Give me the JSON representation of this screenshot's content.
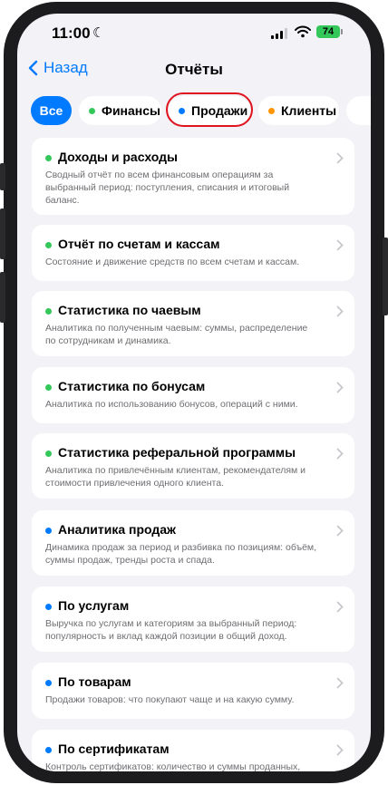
{
  "status": {
    "time": "11:00",
    "battery": "74"
  },
  "nav": {
    "back_label": "Назад",
    "title": "Отчёты"
  },
  "chips": [
    {
      "label": "Все",
      "active": true
    },
    {
      "label": "Финансы",
      "dot": "#34c759"
    },
    {
      "label": "Продажи",
      "dot": "#007aff"
    },
    {
      "label": "Клиенты",
      "dot": "#ff9500"
    }
  ],
  "cards": [
    {
      "title": "Доходы и расходы",
      "dot": "#34c759",
      "desc": "Сводный отчёт по всем финансовым операциям за выбранный период: поступления, списания и итоговый баланс."
    },
    {
      "title": "Отчёт по счетам и кассам",
      "dot": "#34c759",
      "desc": "Состояние и движение средств по всем счетам и кассам."
    },
    {
      "title": "Статистика по чаевым",
      "dot": "#34c759",
      "desc": "Аналитика по полученным чаевым: суммы, распределение по сотрудникам и динамика."
    },
    {
      "title": "Статистика по бонусам",
      "dot": "#34c759",
      "desc": "Аналитика по использованию бонусов, операций с ними."
    },
    {
      "title": "Статистика реферальной программы",
      "dot": "#34c759",
      "desc": "Аналитика по привлечённым клиентам, рекомендателям и стоимости привлечения одного клиента."
    },
    {
      "title": "Аналитика продаж",
      "dot": "#007aff",
      "desc": "Динамика продаж за период и разбивка по позициям: объём, суммы продаж, тренды роста и спада."
    },
    {
      "title": "По услугам",
      "dot": "#007aff",
      "desc": "Выручка по услугам и категориям за выбранный период: популярность и вклад каждой позиции в общий доход."
    },
    {
      "title": "По товарам",
      "dot": "#007aff",
      "desc": "Продажи товаров: что покупают чаще и на какую сумму."
    },
    {
      "title": "По сертификатам",
      "dot": "#007aff",
      "desc": "Контроль сертификатов: количество и суммы проданных,"
    }
  ]
}
